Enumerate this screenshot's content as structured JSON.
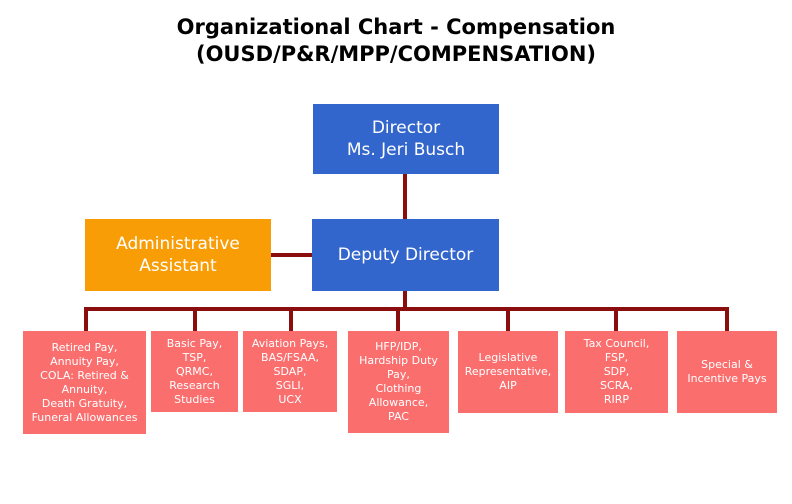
{
  "title": {
    "line1": "Organizational Chart - Compensation",
    "line2": "(OUSD/P&R/MPP/COMPENSATION)"
  },
  "colors": {
    "director_blue": "#3366CC",
    "admin_orange": "#F99D06",
    "branch_red": "#FA6E6E",
    "connector_dark_red": "#8B0E0E",
    "text_white": "#FFFFFF",
    "title_black": "#000000",
    "background": "#FFFFFF"
  },
  "nodes": {
    "director": {
      "label": "Director\nMs. Jeri Busch",
      "title_text": "Director",
      "name_text": "Ms. Jeri Busch"
    },
    "administrative_assistant": {
      "label": "Administrative\nAssistant"
    },
    "deputy_director": {
      "label": "Deputy Director"
    }
  },
  "branches": [
    {
      "id": "retired-pay",
      "label": "Retired Pay,\nAnnuity Pay,\nCOLA: Retired &\nAnnuity,\nDeath Gratuity,\nFuneral Allowances"
    },
    {
      "id": "basic-pay",
      "label": "Basic Pay,\nTSP,\nQRMC,\nResearch\nStudies"
    },
    {
      "id": "aviation-pays",
      "label": "Aviation Pays,\nBAS/FSAA,\nSDAP,\nSGLI,\nUCX"
    },
    {
      "id": "hfp-idp",
      "label": "HFP/IDP,\nHardship Duty\nPay,\nClothing\nAllowance,\nPAC"
    },
    {
      "id": "legislative-rep",
      "label": "Legislative\nRepresentative,\nAIP"
    },
    {
      "id": "tax-council",
      "label": "Tax Council,\nFSP,\nSDP,\nSCRA,\nRIRP"
    },
    {
      "id": "special-incentive",
      "label": "Special &\nIncentive Pays"
    }
  ]
}
